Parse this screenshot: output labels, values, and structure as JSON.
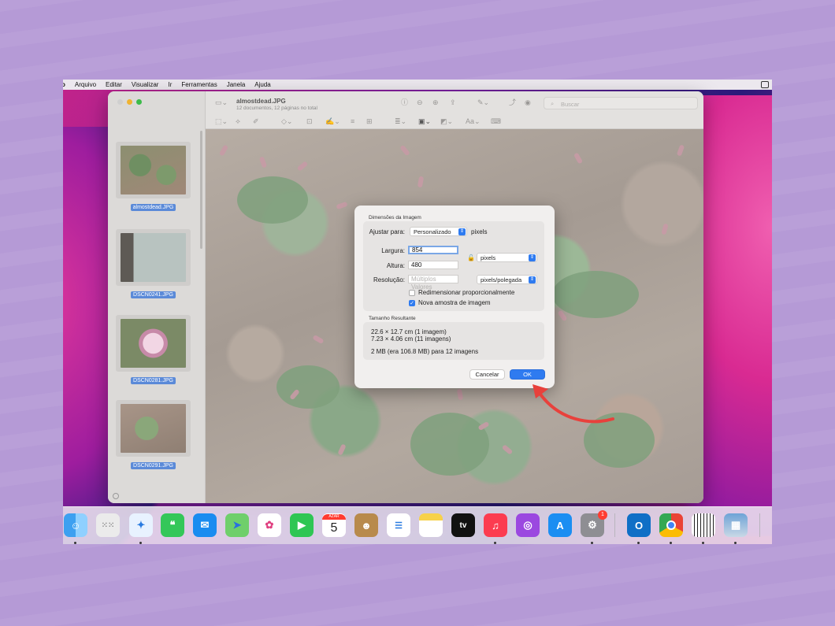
{
  "menubar": {
    "app_partial": "o",
    "items": [
      "Arquivo",
      "Editar",
      "Visualizar",
      "Ir",
      "Ferramentas",
      "Janela",
      "Ajuda"
    ]
  },
  "window": {
    "title": "almostdead.JPG",
    "subtitle": "12 documentos, 12 páginas no total",
    "search_placeholder": "Buscar"
  },
  "sidebar": {
    "thumbnails": [
      {
        "caption": "almostdead.JPG"
      },
      {
        "caption": "DSCN0241.JPG"
      },
      {
        "caption": "DSCN0281.JPG"
      },
      {
        "caption": "DSCN0291.JPG"
      }
    ]
  },
  "dialog": {
    "section1_title": "Dimensões da Imagem",
    "fit_label": "Ajustar para:",
    "fit_value": "Personalizado",
    "fit_unit": "pixels",
    "width_label": "Largura:",
    "width_value": "854",
    "height_label": "Altura:",
    "height_value": "480",
    "unit_value": "pixels",
    "resolution_label": "Resolução:",
    "resolution_placeholder": "Múltiplos Valores",
    "resolution_unit": "pixels/polegada",
    "scale_proportionally": "Redimensionar proporcionalmente",
    "scale_proportionally_checked": false,
    "resample": "Nova amostra de imagem",
    "resample_checked": true,
    "section2_title": "Tamanho Resultante",
    "result_line1": "22.6 × 12.7 cm (1 imagem)",
    "result_line2": "7.23 × 4.06 cm (11 imagens)",
    "result_line3": "2 MB (era 106.8 MB) para 12 imagens",
    "cancel_label": "Cancelar",
    "ok_label": "OK"
  },
  "dock": {
    "calendar_month": "AZAR",
    "calendar_day": "5",
    "tv_label": "tv",
    "settings_badge": "1"
  },
  "colors": {
    "accent": "#2f7bf0",
    "annotation_arrow": "#e8413c"
  }
}
